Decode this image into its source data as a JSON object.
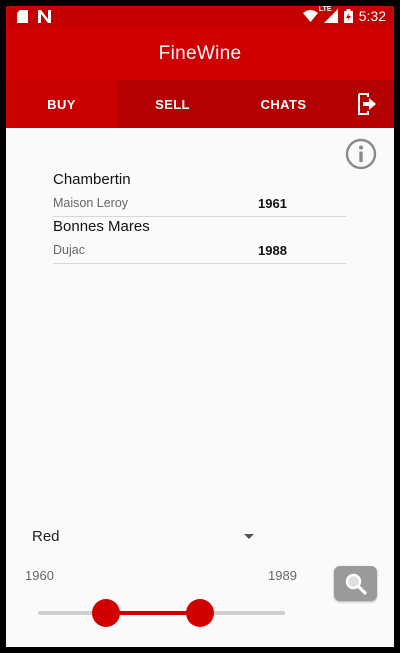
{
  "status_bar": {
    "time": "5:32",
    "network_label": "LTE",
    "icons": [
      "sd-card-icon",
      "n-notification-icon",
      "wifi-icon",
      "signal-icon",
      "battery-charging-icon"
    ]
  },
  "app": {
    "title": "FineWine"
  },
  "tabs": [
    {
      "label": "BUY",
      "active": true
    },
    {
      "label": "SELL",
      "active": false
    },
    {
      "label": "CHATS",
      "active": false
    }
  ],
  "tab_icons": {
    "logout": "logout-icon"
  },
  "info_icon": "info-icon",
  "wines": [
    {
      "name": "Chambertin",
      "producer": "Maison Leroy",
      "year": "1961"
    },
    {
      "name": "Bonnes Mares",
      "producer": "Dujac",
      "year": "1988"
    }
  ],
  "filter": {
    "color": "Red",
    "year_min": "1960",
    "year_max": "1989",
    "range_selected": {
      "low": 1968,
      "high": 1979
    },
    "range_bounds": [
      1960,
      1989
    ]
  },
  "search_icon": "search-icon",
  "colors": {
    "primary": "#d10000",
    "primary_dark": "#b30000",
    "status": "#c40000",
    "button_gray": "#9a9a9a"
  }
}
